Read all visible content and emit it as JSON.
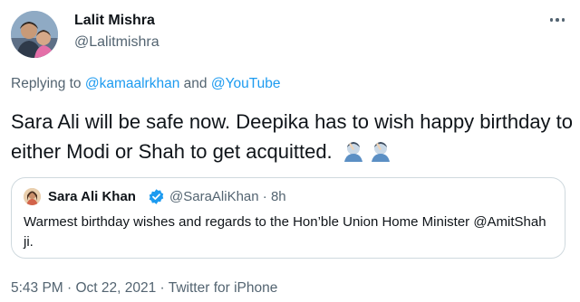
{
  "author": {
    "name": "Lalit Mishra",
    "handle": "@Lalitmishra"
  },
  "reply": {
    "prefix": "Replying to ",
    "mention_1": "@kamaalrkhan",
    "connector": " and ",
    "mention_2": "@YouTube"
  },
  "tweet": {
    "text": "Sara Ali will be safe now. Deepika has to wish happy birthday to either Modi or Shah to get acquitted.",
    "emoji_icons": [
      "facepalm-icon",
      "facepalm-icon"
    ]
  },
  "quoted": {
    "name": "Sara Ali Khan",
    "handle": "@SaraAliKhan",
    "separator": " · ",
    "time": "8h",
    "text": "Warmest birthday wishes and regards to the Hon’ble Union Home Minister @AmitShah ji."
  },
  "footer": {
    "time": "5:43 PM",
    "date": "Oct 22, 2021",
    "client": "Twitter for iPhone",
    "full": "5:43 PM · Oct 22, 2021 · Twitter for iPhone"
  },
  "colors": {
    "link": "#1d9bf0",
    "secondary_text": "#536471",
    "border": "#cfd9de"
  }
}
